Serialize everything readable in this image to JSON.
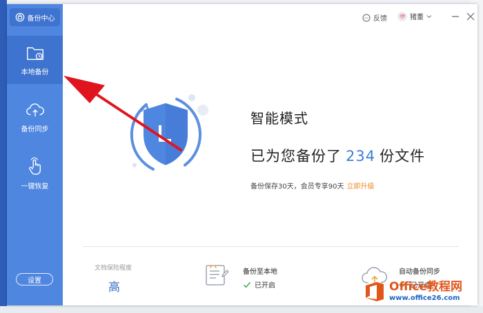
{
  "window": {
    "brand_label": "备份中心"
  },
  "sidebar": {
    "items": [
      {
        "label": "本地备份",
        "icon": "folder-clock-icon",
        "active": true
      },
      {
        "label": "备份同步",
        "icon": "cloud-upload-icon",
        "active": false
      },
      {
        "label": "一键恢复",
        "icon": "hand-pointer-icon",
        "active": false
      }
    ],
    "settings_label": "设置"
  },
  "titlebar": {
    "feedback_label": "反馈",
    "username": "猪重"
  },
  "hero": {
    "mode_title": "智能模式",
    "backup_prefix": "已为您备份了",
    "backup_count": "234",
    "backup_suffix": "份文件",
    "note": "备份保存30天，会员专享90天",
    "upgrade_link": "立即升级"
  },
  "status": {
    "protect_label": "文档保险程度",
    "protect_value": "高",
    "local_title": "备份至本地",
    "local_state": "已开启",
    "sync_title": "自动备份同步",
    "sync_state": "已开启"
  },
  "watermark": {
    "brand": "Office教程网",
    "url": "www.office26.com"
  },
  "colors": {
    "sidebar": "#4f86e0",
    "accent": "#3b7fd8",
    "upgrade": "#f08a24",
    "check": "#3cb44b",
    "annotation_arrow": "#e0141e"
  }
}
